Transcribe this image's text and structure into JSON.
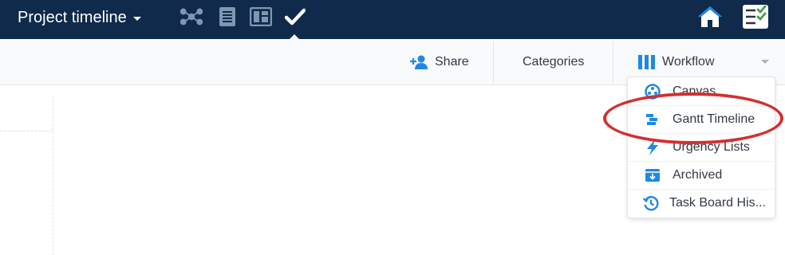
{
  "header": {
    "project_title": "Project timeline",
    "view_icons": [
      "mindmap-icon",
      "document-icon",
      "board-icon",
      "checkmark-icon"
    ],
    "active_view": "checkmark-icon",
    "right_icons": [
      "home-icon",
      "checklist-icon"
    ]
  },
  "toolbar": {
    "share_label": "Share",
    "categories_label": "Categories",
    "workflow_label": "Workflow"
  },
  "menu": {
    "items": [
      {
        "label": "Canvas",
        "icon": "canvas-icon"
      },
      {
        "label": "Gantt Timeline",
        "icon": "gantt-icon"
      },
      {
        "label": "Urgency Lists",
        "icon": "lightning-icon"
      },
      {
        "label": "Archived",
        "icon": "archive-icon"
      },
      {
        "label": "Task Board His...",
        "icon": "history-icon"
      }
    ],
    "highlighted_item": "Gantt Timeline"
  },
  "colors": {
    "topbar": "#0f2a4a",
    "accent": "#1e88e5",
    "highlight": "#d32f2f",
    "icon_muted": "#7f97b2"
  }
}
